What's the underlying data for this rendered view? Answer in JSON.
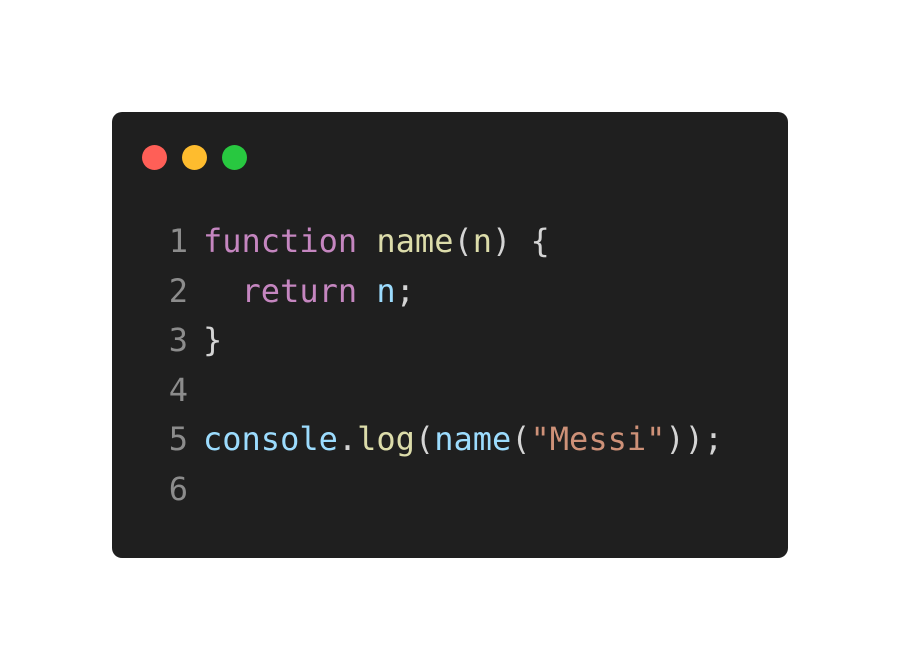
{
  "colors": {
    "window_background": "#1f1f1f",
    "close": "#ff5f57",
    "minimize": "#febc2e",
    "maximize": "#28c840",
    "line_number": "#8c8c8c",
    "keyword": "#c586c0",
    "function": "#dcdcaa",
    "variable": "#9cdcfe",
    "string": "#ce9178",
    "punctuation": "#d4d4d4"
  },
  "window_controls": [
    {
      "name": "close-dot",
      "color": "#ff5f57"
    },
    {
      "name": "minimize-dot",
      "color": "#febc2e"
    },
    {
      "name": "maximize-dot",
      "color": "#28c840"
    }
  ],
  "code_lines": [
    {
      "number": "1",
      "tokens": [
        {
          "text": "function",
          "kind": "keyword"
        },
        {
          "text": " ",
          "kind": "punctuation"
        },
        {
          "text": "name",
          "kind": "function"
        },
        {
          "text": "(",
          "kind": "punctuation"
        },
        {
          "text": "n",
          "kind": "function"
        },
        {
          "text": ") {",
          "kind": "punctuation"
        }
      ]
    },
    {
      "number": "2",
      "tokens": [
        {
          "text": "  ",
          "kind": "punctuation"
        },
        {
          "text": "return",
          "kind": "keyword"
        },
        {
          "text": " ",
          "kind": "punctuation"
        },
        {
          "text": "n",
          "kind": "variable"
        },
        {
          "text": ";",
          "kind": "punctuation"
        }
      ]
    },
    {
      "number": "3",
      "tokens": [
        {
          "text": "}",
          "kind": "punctuation"
        }
      ]
    },
    {
      "number": "4",
      "tokens": []
    },
    {
      "number": "5",
      "tokens": [
        {
          "text": "console",
          "kind": "variable"
        },
        {
          "text": ".",
          "kind": "punctuation"
        },
        {
          "text": "log",
          "kind": "function"
        },
        {
          "text": "(",
          "kind": "punctuation"
        },
        {
          "text": "name",
          "kind": "variable"
        },
        {
          "text": "(",
          "kind": "punctuation"
        },
        {
          "text": "\"Messi\"",
          "kind": "string"
        },
        {
          "text": "));",
          "kind": "punctuation"
        }
      ]
    },
    {
      "number": "6",
      "tokens": []
    }
  ]
}
